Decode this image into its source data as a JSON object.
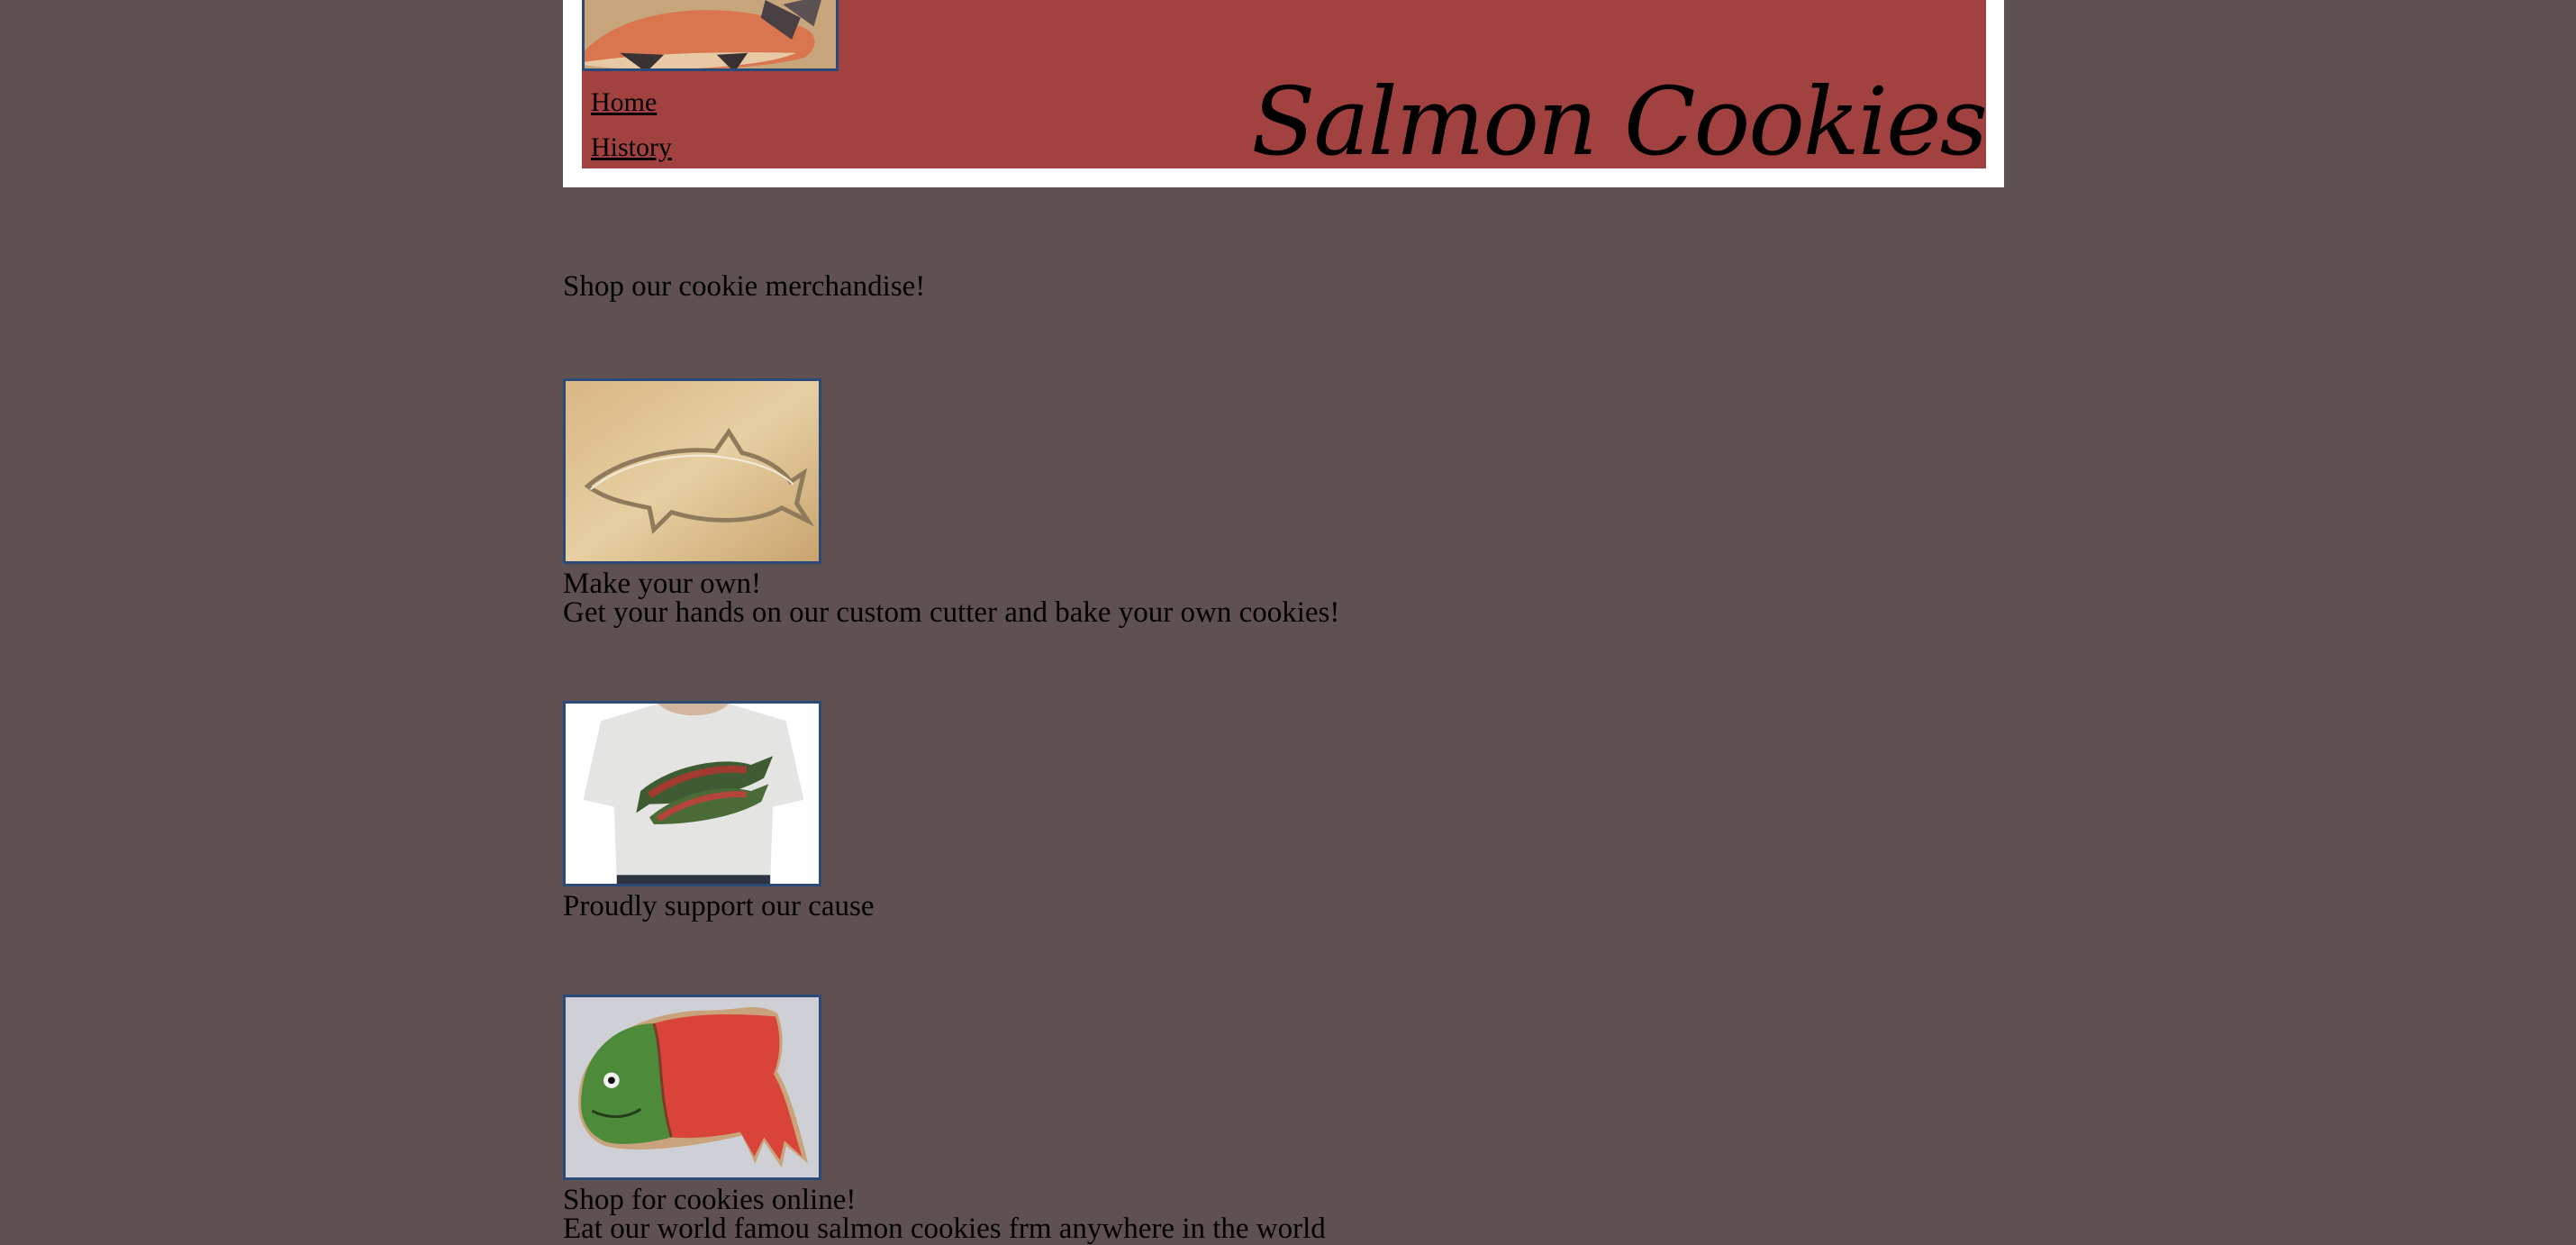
{
  "header": {
    "title": "Salmon Cookies",
    "logo_icon": "salmon-illustration-icon",
    "nav": [
      {
        "label": "Home"
      },
      {
        "label": "History"
      }
    ]
  },
  "main": {
    "intro": "Shop our cookie merchandise!",
    "products": [
      {
        "title": "Make your own!",
        "description": "Get your hands on our custom cutter and bake your own cookies!",
        "image_icon": "salmon-cookie-cutter-icon"
      },
      {
        "title": "Proudly support our cause",
        "description": "",
        "image_icon": "salmon-tshirt-icon"
      },
      {
        "title": "Shop for cookies online!",
        "description": "Eat our world famou salmon cookies frm anywhere in the world",
        "image_icon": "salmon-cookie-icon"
      }
    ]
  },
  "colors": {
    "page_background": "#5f5152",
    "header_background": "#a24240",
    "header_frame": "#ffffff",
    "image_border": "#2c4a78"
  }
}
